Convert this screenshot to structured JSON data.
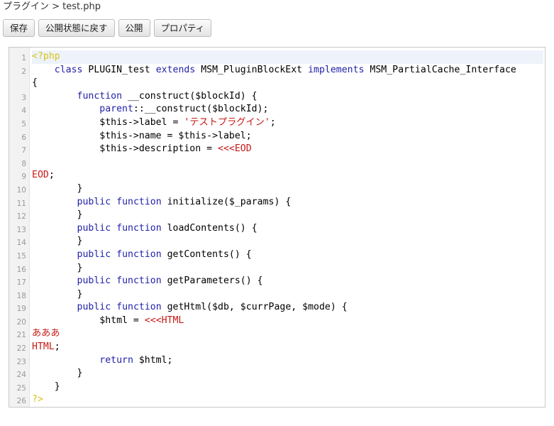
{
  "breadcrumb": {
    "text": "プラグイン > test.php"
  },
  "toolbar": {
    "save_label": "保存",
    "unpublish_label": "公開状態に戻す",
    "publish_label": "公開",
    "properties_label": "プロパティ"
  },
  "editor": {
    "lines": [
      {
        "n": "1",
        "tokens": [
          [
            "php",
            "<?php"
          ]
        ]
      },
      {
        "n": "2",
        "tokens": [
          [
            "plain",
            "    "
          ],
          [
            "kw",
            "class"
          ],
          [
            "plain",
            " PLUGIN_test "
          ],
          [
            "kw",
            "extends"
          ],
          [
            "plain",
            " MSM_PluginBlockExt "
          ],
          [
            "kw",
            "implements"
          ],
          [
            "plain",
            " MSM_PartialCache_Interface"
          ]
        ],
        "wrap": [
          [
            "plain",
            "{"
          ]
        ]
      },
      {
        "n": "3",
        "tokens": [
          [
            "plain",
            "        "
          ],
          [
            "kw",
            "function"
          ],
          [
            "plain",
            " __construct($blockId) {"
          ]
        ]
      },
      {
        "n": "4",
        "tokens": [
          [
            "plain",
            "            "
          ],
          [
            "kw",
            "parent"
          ],
          [
            "plain",
            "::__construct($blockId);"
          ]
        ]
      },
      {
        "n": "5",
        "tokens": [
          [
            "plain",
            "            $this->label = "
          ],
          [
            "str",
            "'テストプラグイン'"
          ],
          [
            "plain",
            ";"
          ]
        ]
      },
      {
        "n": "6",
        "tokens": [
          [
            "plain",
            "            $this->name = $this->label;"
          ]
        ]
      },
      {
        "n": "7",
        "tokens": [
          [
            "plain",
            "            $this->description = "
          ],
          [
            "str",
            "<<<EOD"
          ]
        ]
      },
      {
        "n": "8",
        "tokens": []
      },
      {
        "n": "9",
        "tokens": [
          [
            "red",
            "EOD"
          ],
          [
            "plain",
            ";"
          ]
        ]
      },
      {
        "n": "10",
        "tokens": [
          [
            "plain",
            "        }"
          ]
        ]
      },
      {
        "n": "11",
        "tokens": [
          [
            "plain",
            "        "
          ],
          [
            "kw",
            "public"
          ],
          [
            "plain",
            " "
          ],
          [
            "kw",
            "function"
          ],
          [
            "plain",
            " initialize($_params) {"
          ]
        ]
      },
      {
        "n": "12",
        "tokens": [
          [
            "plain",
            "        }"
          ]
        ]
      },
      {
        "n": "13",
        "tokens": [
          [
            "plain",
            "        "
          ],
          [
            "kw",
            "public"
          ],
          [
            "plain",
            " "
          ],
          [
            "kw",
            "function"
          ],
          [
            "plain",
            " loadContents() {"
          ]
        ]
      },
      {
        "n": "14",
        "tokens": [
          [
            "plain",
            "        }"
          ]
        ]
      },
      {
        "n": "15",
        "tokens": [
          [
            "plain",
            "        "
          ],
          [
            "kw",
            "public"
          ],
          [
            "plain",
            " "
          ],
          [
            "kw",
            "function"
          ],
          [
            "plain",
            " getContents() {"
          ]
        ]
      },
      {
        "n": "16",
        "tokens": [
          [
            "plain",
            "        }"
          ]
        ]
      },
      {
        "n": "17",
        "tokens": [
          [
            "plain",
            "        "
          ],
          [
            "kw",
            "public"
          ],
          [
            "plain",
            " "
          ],
          [
            "kw",
            "function"
          ],
          [
            "plain",
            " getParameters() {"
          ]
        ]
      },
      {
        "n": "18",
        "tokens": [
          [
            "plain",
            "        }"
          ]
        ]
      },
      {
        "n": "19",
        "tokens": [
          [
            "plain",
            "        "
          ],
          [
            "kw",
            "public"
          ],
          [
            "plain",
            " "
          ],
          [
            "kw",
            "function"
          ],
          [
            "plain",
            " getHtml($db, $currPage, $mode) {"
          ]
        ]
      },
      {
        "n": "20",
        "tokens": [
          [
            "plain",
            "            $html = "
          ],
          [
            "str",
            "<<<HTML"
          ]
        ]
      },
      {
        "n": "21",
        "tokens": [
          [
            "red",
            "あああ"
          ]
        ]
      },
      {
        "n": "22",
        "tokens": [
          [
            "red",
            "HTML"
          ],
          [
            "plain",
            ";"
          ]
        ]
      },
      {
        "n": "23",
        "tokens": [
          [
            "plain",
            "            "
          ],
          [
            "kw",
            "return"
          ],
          [
            "plain",
            " $html;"
          ]
        ]
      },
      {
        "n": "24",
        "tokens": [
          [
            "plain",
            "        }"
          ]
        ]
      },
      {
        "n": "25",
        "tokens": [
          [
            "plain",
            "    }"
          ]
        ]
      },
      {
        "n": "26",
        "tokens": [
          [
            "php",
            "?>"
          ]
        ]
      }
    ]
  },
  "colors": {
    "keyword": "#1f1fa8",
    "string": "#c41a16",
    "php_tag": "#d4c51a"
  }
}
